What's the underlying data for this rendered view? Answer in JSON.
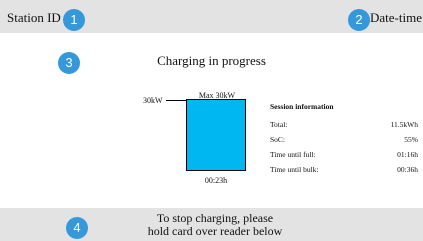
{
  "colors": {
    "marker": "#3498db",
    "battery_fill": "#00b7f1",
    "bar_background": "#e3e3e3"
  },
  "header": {
    "station_id": "Station ID",
    "date_time": "Date-time"
  },
  "markers": [
    "1",
    "2",
    "3",
    "4"
  ],
  "main": {
    "title": "Charging in progress",
    "battery": {
      "max_label": "Max 30kW",
      "current_label": "30kW",
      "time_label": "00:23h",
      "fill_fraction": 1.0
    },
    "session": {
      "title": "Session information",
      "rows": [
        {
          "label": "Total:",
          "value": "11.5kWh"
        },
        {
          "label": "SoC:",
          "value": "55%"
        },
        {
          "label": "Time until full:",
          "value": "01:16h"
        },
        {
          "label": "Time until bulk:",
          "value": "00:36h"
        }
      ]
    }
  },
  "footer": {
    "line1": "To stop charging, please",
    "line2": "hold card over reader below"
  }
}
